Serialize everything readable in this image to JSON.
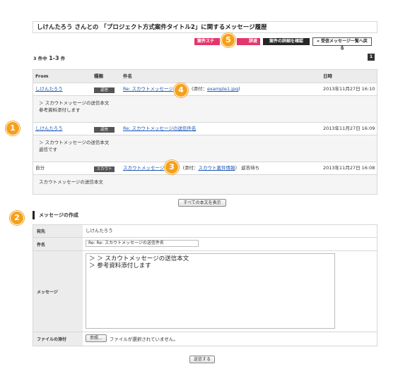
{
  "page_title": "しけんたろう さんとの 「プロジェクト方式案件タイトル2」に関するメッセージ履歴",
  "toolbar": {
    "status_button": "案件ステータス",
    "status_button_tail": "辞退",
    "detail_button": "案件の詳細を確認",
    "back_button_icon": "«",
    "back_button": "受信メッセージ一覧へ戻る"
  },
  "result_count": {
    "prefix": "3 件中",
    "range": "1-3",
    "suffix": "件"
  },
  "pagination": {
    "current": "1"
  },
  "table": {
    "headers": {
      "from": "From",
      "type": "種類",
      "subject": "件名",
      "date": "日時"
    },
    "rows": [
      {
        "from": "しけんたろう",
        "type": "返信",
        "subject": "Re: スカウトメッセージ",
        "attach_prefix": "(添付：",
        "attach_file": "example1.jpg",
        "attach_suffix": ")",
        "status": "",
        "date": "2013年11月27日 16:10",
        "body_line1": "＞ スカウトメッセージの送信本文",
        "body_line2": "参考資料添付します"
      },
      {
        "from": "しけんたろう",
        "type": "返信",
        "subject": "Re: スカウトメッセージの送信件名",
        "attach_prefix": "",
        "attach_file": "",
        "attach_suffix": "",
        "status": "",
        "date": "2013年11月27日 16:09",
        "body_line1": "＞ スカウトメッセージの送信本文",
        "body_line2": "返信です"
      },
      {
        "from": "自分",
        "type": "スカウト",
        "subject": "スカウトメッセージ",
        "attach_prefix": "(添付：",
        "attach_file": "スカウト案件情報",
        "attach_suffix": ")",
        "status": "返答待ち",
        "date": "2013年11月27日 16:08",
        "body_line1": "スカウトメッセージの送信本文",
        "body_line2": ""
      }
    ]
  },
  "show_all_button": "すべての本文を表示",
  "compose": {
    "heading": "メッセージの作成",
    "to_label": "宛先",
    "to_value": "しけんたろう",
    "subject_label": "件名",
    "subject_value": "Re: Re: スカウトメッセージの送信件名",
    "message_label": "メッセージ",
    "message_value": "＞ ＞ スカウトメッセージの送信本文\n＞ 参考資料添付します",
    "attach_label": "ファイルの添付",
    "browse_button": "参照...",
    "no_file_text": "ファイルが選択されていません。",
    "send_button": "送信する"
  },
  "callouts": {
    "c1": "1",
    "c2": "2",
    "c3": "3",
    "c4": "4",
    "c5": "5"
  },
  "colors": {
    "accent_pink": "#e3366d",
    "callout_orange": "#f5a01c",
    "link_blue": "#1a55b5"
  }
}
